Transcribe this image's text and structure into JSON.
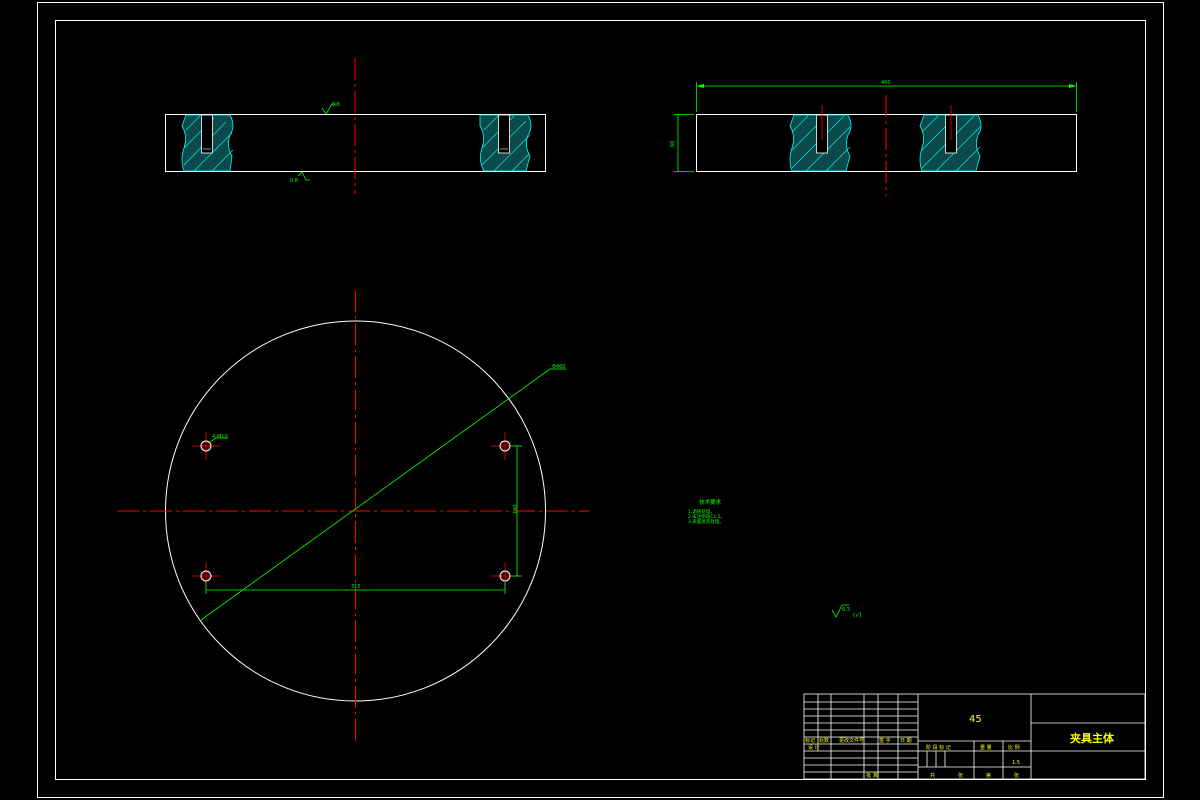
{
  "colors": {
    "background": "#000000",
    "outline": "#ffffff",
    "dimension": "#00ff00",
    "centerline": "#ff0000",
    "hatch": "#00ffff"
  },
  "drawing": {
    "front_view": {
      "surface_finish_top": "6.3",
      "surface_finish_bottom": "0.8"
    },
    "side_view": {
      "width_dim": "460",
      "height_dim": "60"
    },
    "plan_view": {
      "diameter_label": "Φ460",
      "hole_callout": "4-M10",
      "hole_spacing_x": "315",
      "hole_spacing_y": "140"
    },
    "tech_notes": {
      "title": "技术要求",
      "lines": [
        "1.调质处理。",
        "2.未注倒角C1.5。",
        "3.表面发黑处理。"
      ]
    },
    "roughness_note": {
      "value": "6.3",
      "suffix": "(√)"
    }
  },
  "title_block": {
    "material": "45",
    "part_name": "夹具主体",
    "change_headers": [
      "标记",
      "处数",
      "更改文件号",
      "签 字",
      "日 期"
    ],
    "row_design": "设 计",
    "row_review": "审 核",
    "stage_header": [
      "阶 段 标 记",
      "重 量",
      "比 例"
    ],
    "scale": "1:5",
    "sheet_info": [
      "共",
      "张",
      "第",
      "张"
    ],
    "approve": "批 准"
  }
}
